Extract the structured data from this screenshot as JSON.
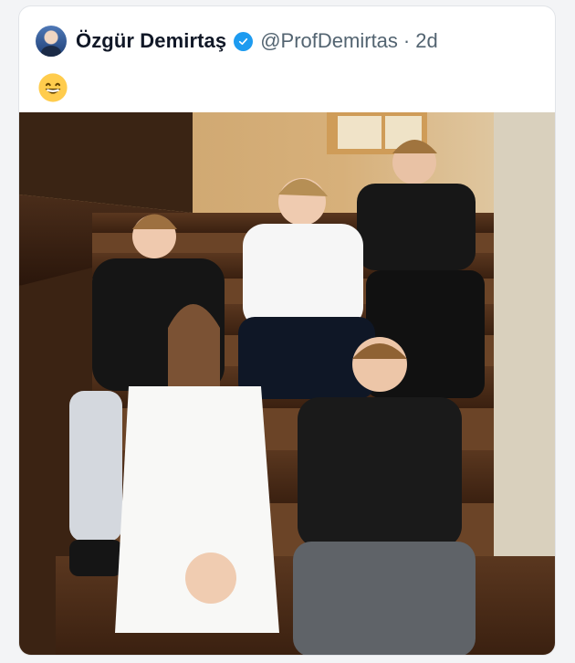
{
  "tweet": {
    "author_name": "Özgür Demirtaş",
    "handle": "@ProfDemirtas",
    "separator": "·",
    "timestamp": "2d",
    "text_emoji": "😄",
    "icons": {
      "avatar": "profile-avatar",
      "verified": "verified-badge-icon"
    },
    "colors": {
      "verified_blue": "#1d9bf0",
      "muted_text": "#536471",
      "primary_text": "#111827"
    }
  }
}
